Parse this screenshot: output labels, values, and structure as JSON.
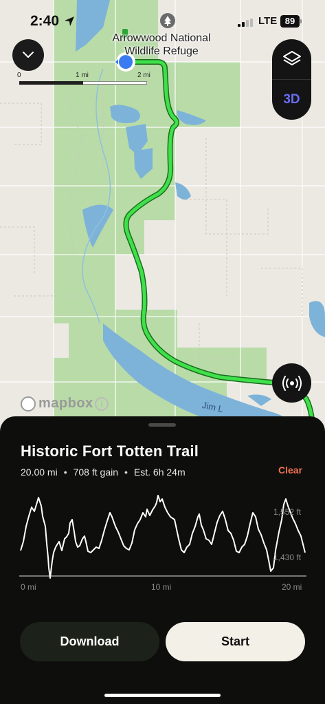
{
  "status_bar": {
    "time": "2:40",
    "network": "LTE",
    "battery": "89"
  },
  "map": {
    "place_label": "Arrowwood National Wildlife Refuge",
    "place_icon": "tree-icon",
    "scale_labels": [
      "0",
      "1 mi",
      "2 mi"
    ],
    "layer_toggle_label": "3D",
    "attribution": "mapbox",
    "info_symbol": "i",
    "river_label": "Jim L",
    "colors": {
      "refuge_green": "#b9dba8",
      "route": "#3fe04a",
      "water": "#7db3d8",
      "land": "#ece9e3"
    }
  },
  "sheet": {
    "trail_name": "Historic Fort Totten Trail",
    "distance": "20.00 mi",
    "gain": "708 ft gain",
    "estimate": "Est. 6h 24m",
    "separator": "•",
    "clear_label": "Clear",
    "elevation_max_label": "1,552 ft",
    "elevation_min_label": "1,430 ft",
    "x_labels": [
      "0 mi",
      "10 mi",
      "20 mi"
    ],
    "download_label": "Download",
    "start_label": "Start"
  },
  "colors": {
    "sheet_bg": "#0e0f0c",
    "accent_clear": "#f07152",
    "three_d": "#6a6df7"
  }
}
